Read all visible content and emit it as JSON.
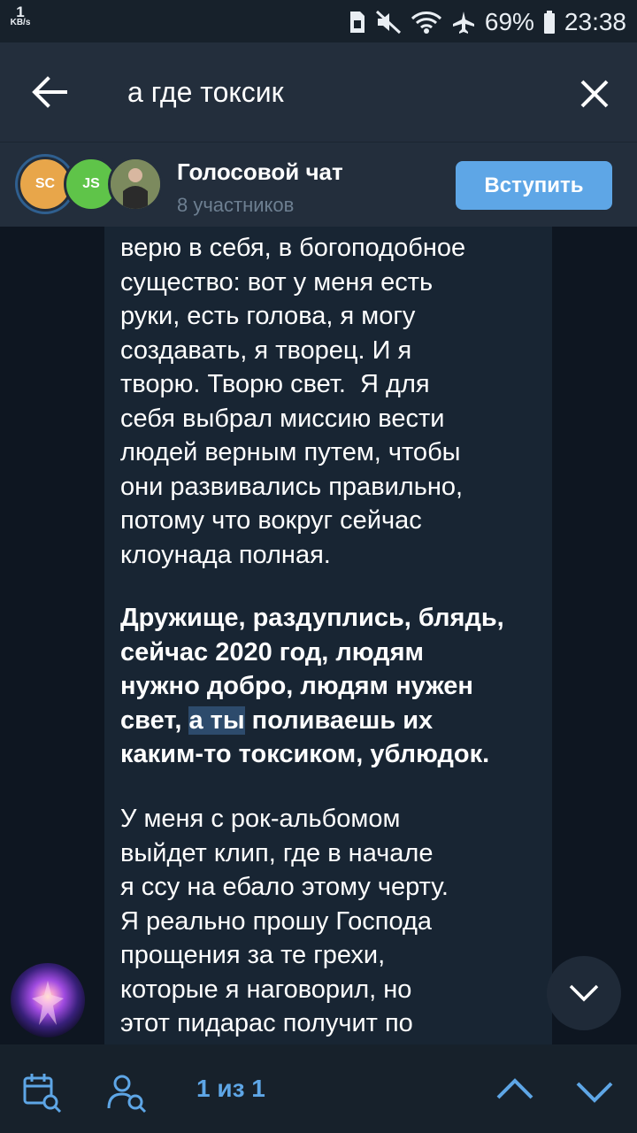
{
  "status_bar": {
    "net_speed": "1",
    "net_unit": "KB/s",
    "battery": "69%",
    "time": "23:38",
    "icons": [
      "sim-icon",
      "mute-icon",
      "wifi-icon",
      "airplane-icon",
      "battery-icon"
    ]
  },
  "search": {
    "value": "а где токсик"
  },
  "voice_chat": {
    "avatar1": "SC",
    "avatar2": "JS",
    "title": "Голосовой чат",
    "subtitle": "8 участников",
    "join_label": "Вступить"
  },
  "message": {
    "p1": "верю в себя, в богоподобное\nсущество: вот у меня есть\nруки, есть голова, я могу\nсоздавать, я творец. И я\nтворю. Творю свет.  Я для\nсебя выбрал миссию вести\nлюдей верным путем, чтобы\nони развивались правильно,\nпотому что вокруг сейчас\nклоунада полная.",
    "p2_before": "Дружище, раздуплись, блядь,\nсейчас 2020 год, людям\nнужно добро, людям нужен\nсвет, ",
    "p2_highlight": "а ты",
    "p2_after": " поливаешь их\nкаким-то токсиком, ублюдок.",
    "p3": "У меня с рок-альбомом\nвыйдет клип, где в начале\nя ссу на ебало этому черту.\nЯ реально прошу Господа\nпрощения за те грехи,\nкоторые я наговорил, но\nэтот пидарас получит по"
  },
  "search_nav": {
    "counter": "1 из 1"
  },
  "colors": {
    "accent": "#5ea6e6",
    "header_bg": "#232e3c",
    "chat_bg": "#0e1621",
    "bubble_bg": "#182533"
  }
}
